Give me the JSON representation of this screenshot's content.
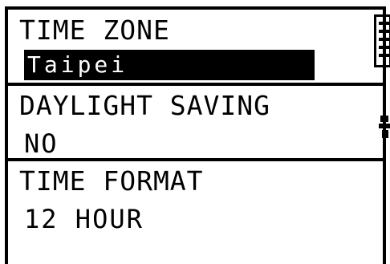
{
  "time_zone": {
    "label": "TIME ZONE",
    "value": "Taipei"
  },
  "daylight_saving": {
    "label": "DAYLIGHT SAVING",
    "value": "NO"
  },
  "time_format": {
    "label": "TIME FORMAT",
    "value": "12 HOUR"
  },
  "icons": {
    "top_right": "battery-icon",
    "middle_right": "satellite-icon"
  },
  "colors": {
    "background": "#ffffff",
    "foreground": "#000000",
    "highlight_bg": "#000000",
    "highlight_fg": "#ffffff"
  }
}
